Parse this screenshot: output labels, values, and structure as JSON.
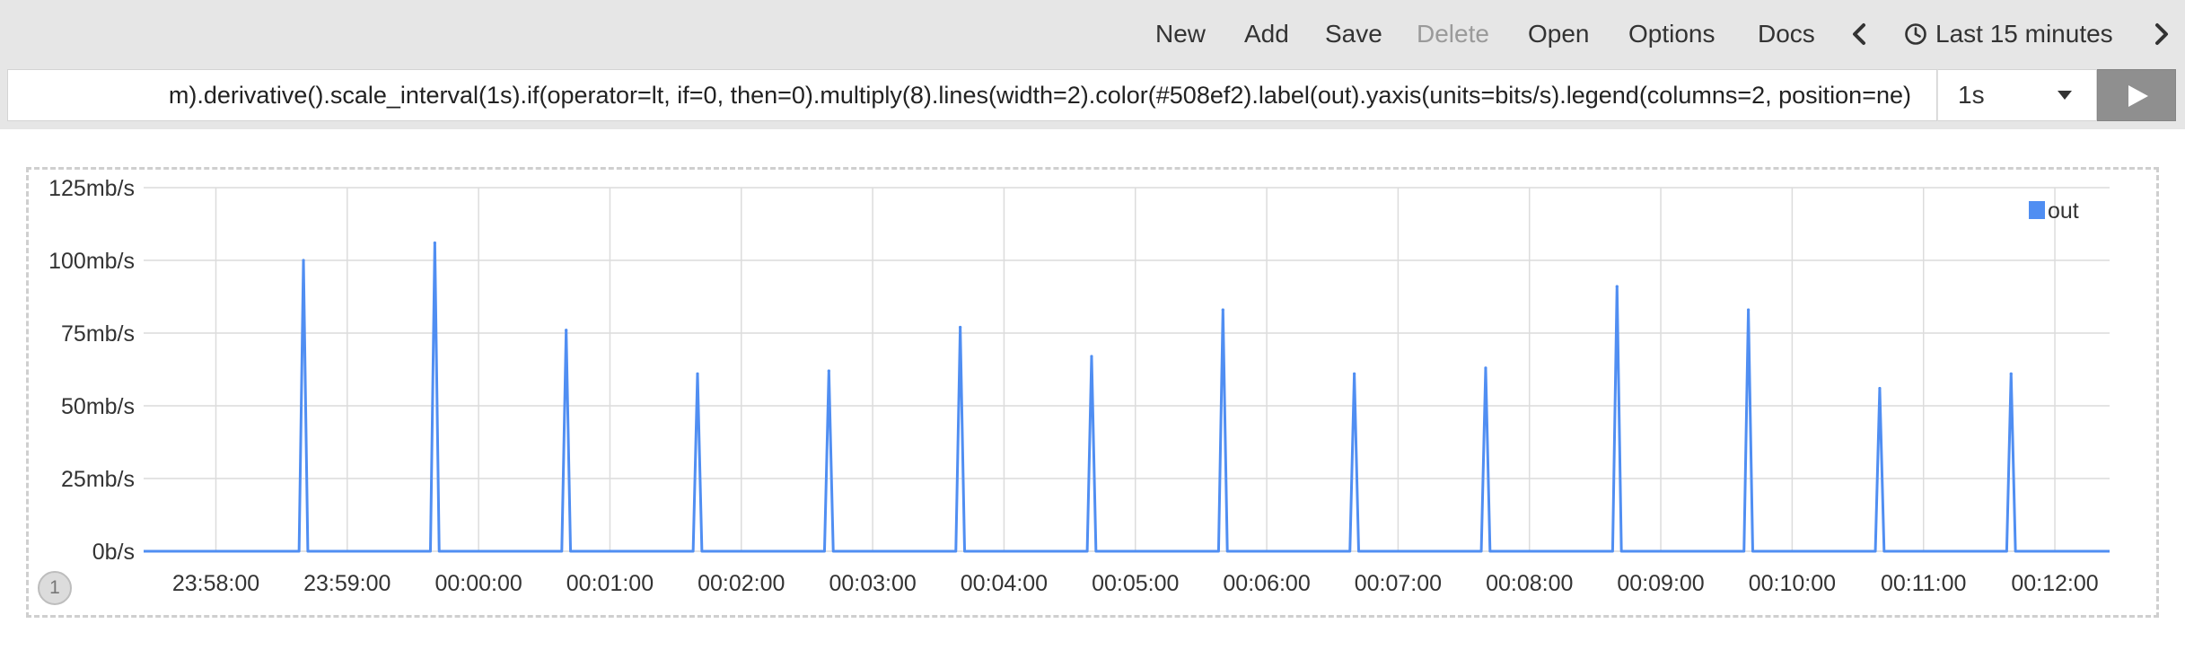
{
  "navbar": {
    "items": [
      {
        "label": "New",
        "enabled": true
      },
      {
        "label": "Add",
        "enabled": true
      },
      {
        "label": "Save",
        "enabled": true
      },
      {
        "label": "Delete",
        "enabled": false
      },
      {
        "label": "Open",
        "enabled": true
      },
      {
        "label": "Options",
        "enabled": true
      },
      {
        "label": "Docs",
        "enabled": true
      }
    ],
    "prev_icon": "chevron-left-icon",
    "next_icon": "chevron-right-icon",
    "clock_icon": "clock-icon",
    "time_range_label": "Last 15 minutes"
  },
  "query": {
    "expression_visible": "m).derivative().scale_interval(1s).if(operator=lt, if=0, then=0).multiply(8).lines(width=2).color(#508ef2).label(out).yaxis(units=bits/s).legend(columns=2, position=ne)"
  },
  "interval": {
    "value": "1s",
    "icon": "caret-down-icon"
  },
  "run_button": {
    "icon": "play-icon"
  },
  "panel": {
    "badge": "1"
  },
  "colors": {
    "series": "#508ef2",
    "toolbar": "#e6e6e6",
    "run_button": "#8f8f8f"
  },
  "chart_data": {
    "type": "line",
    "y_unit": "bits/s",
    "ylim": [
      0,
      125
    ],
    "yticks": [
      0,
      25,
      50,
      75,
      100,
      125
    ],
    "ytick_labels": [
      "0b/s",
      "25mb/s",
      "50mb/s",
      "75mb/s",
      "100mb/s",
      "125mb/s"
    ],
    "x_range": [
      "23:57:27",
      "00:12:25"
    ],
    "xticks": [
      "23:58:00",
      "23:59:00",
      "00:00:00",
      "00:01:00",
      "00:02:00",
      "00:03:00",
      "00:04:00",
      "00:05:00",
      "00:06:00",
      "00:07:00",
      "00:08:00",
      "00:09:00",
      "00:10:00",
      "00:11:00",
      "00:12:00"
    ],
    "grid": true,
    "legend_position": "top-right",
    "series": [
      {
        "name": "out",
        "color": "#508ef2",
        "baseline": 0,
        "spikes": [
          {
            "t": "23:58:40",
            "v": 100
          },
          {
            "t": "23:59:40",
            "v": 106
          },
          {
            "t": "00:00:40",
            "v": 76
          },
          {
            "t": "00:01:40",
            "v": 61
          },
          {
            "t": "00:02:40",
            "v": 62
          },
          {
            "t": "00:03:40",
            "v": 77
          },
          {
            "t": "00:04:40",
            "v": 67
          },
          {
            "t": "00:05:40",
            "v": 83
          },
          {
            "t": "00:06:40",
            "v": 61
          },
          {
            "t": "00:07:40",
            "v": 63
          },
          {
            "t": "00:08:40",
            "v": 91
          },
          {
            "t": "00:09:40",
            "v": 83
          },
          {
            "t": "00:10:40",
            "v": 56
          },
          {
            "t": "00:11:40",
            "v": 61
          }
        ]
      }
    ]
  }
}
